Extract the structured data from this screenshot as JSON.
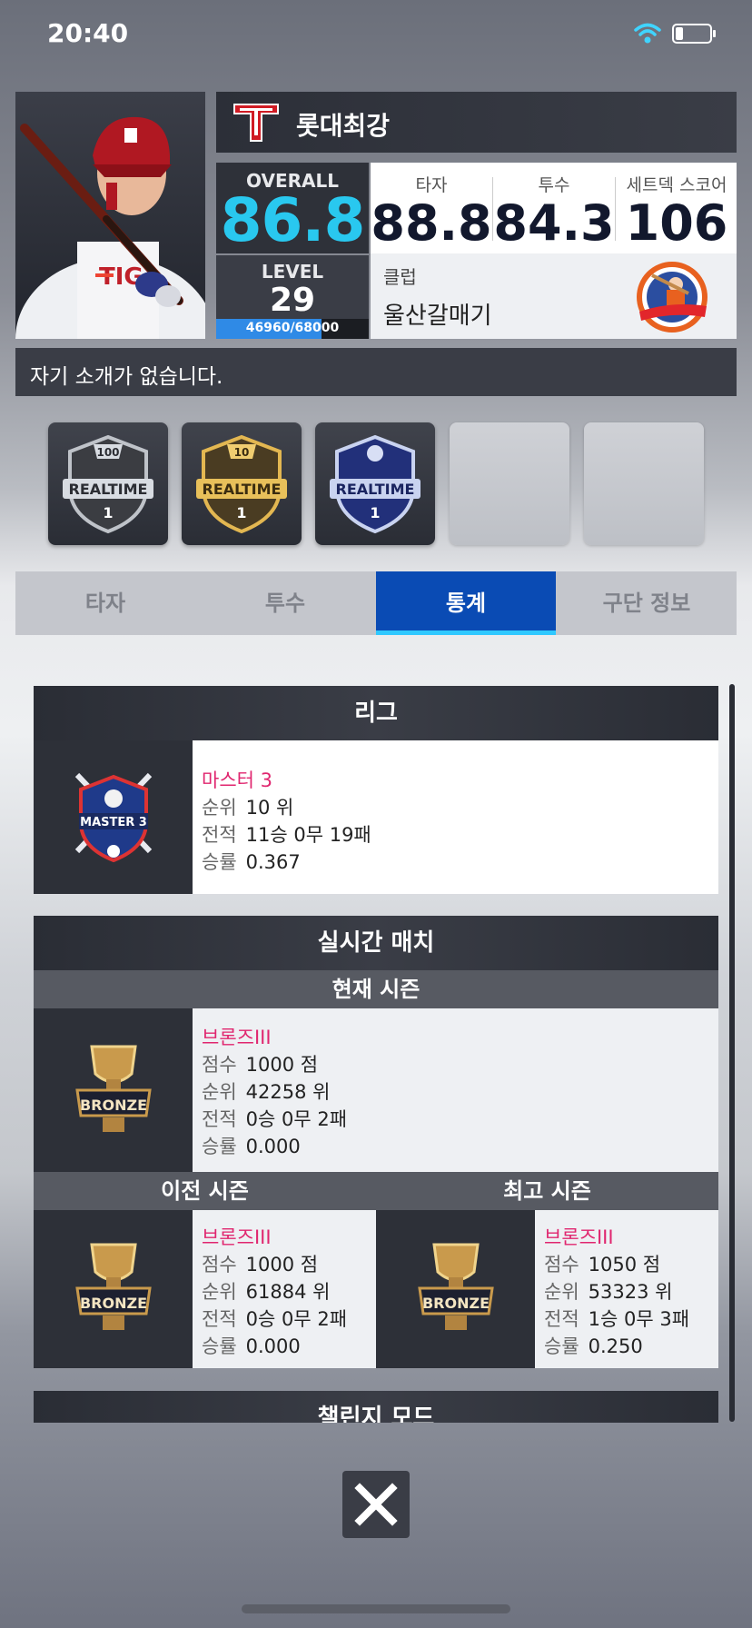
{
  "status": {
    "time": "20:40"
  },
  "profile": {
    "name": "롯대최강",
    "overall_label": "OVERALL",
    "overall_value": "86.8",
    "level_label": "LEVEL",
    "level_value": "29",
    "exp_text": "46960/68000",
    "exp_fraction": 0.69,
    "hitter_label": "타자",
    "hitter_value": "88.8",
    "pitcher_label": "투수",
    "pitcher_value": "84.3",
    "setdeck_label": "세트덱 스코어",
    "setdeck_value": "106",
    "club_label": "클럽",
    "club_value": "울산갈매기",
    "intro": "자기 소개가 없습니다."
  },
  "badges": [
    {
      "number": "100",
      "text": "REALTIME",
      "rank": "1",
      "tone": "silver"
    },
    {
      "number": "10",
      "text": "REALTIME",
      "rank": "1",
      "tone": "gold"
    },
    {
      "number": "",
      "text": "REALTIME",
      "rank": "1",
      "tone": "blue"
    }
  ],
  "tabs": [
    {
      "label": "타자"
    },
    {
      "label": "투수"
    },
    {
      "label": "통계"
    },
    {
      "label": "구단 정보"
    }
  ],
  "active_tab": "통계",
  "league": {
    "title": "리그",
    "emblem_text": "MASTER 3",
    "tier": "마스터 3",
    "rank_key": "순위",
    "rank_val": "10 위",
    "record_key": "전적",
    "record_val": "11승 0무 19패",
    "winrate_key": "승률",
    "winrate_val": "0.367"
  },
  "realtime": {
    "title": "실시간 매치",
    "current": {
      "title": "현재 시즌",
      "tier": "브론즈III",
      "score_key": "점수",
      "score_val": "1000 점",
      "rank_key": "순위",
      "rank_val": "42258 위",
      "record_key": "전적",
      "record_val": "0승 0무 2패",
      "winrate_key": "승률",
      "winrate_val": "0.000"
    },
    "previous": {
      "title": "이전 시즌",
      "tier": "브론즈III",
      "score_key": "점수",
      "score_val": "1000 점",
      "rank_key": "순위",
      "rank_val": "61884 위",
      "record_key": "전적",
      "record_val": "0승 0무 2패",
      "winrate_key": "승률",
      "winrate_val": "0.000"
    },
    "best": {
      "title": "최고 시즌",
      "tier": "브론즈III",
      "score_key": "점수",
      "score_val": "1050 점",
      "rank_key": "순위",
      "rank_val": "53323 위",
      "record_key": "전적",
      "record_val": "1승 0무 3패",
      "winrate_key": "승률",
      "winrate_val": "0.250"
    },
    "emblem_text": "BRONZE"
  },
  "challenge": {
    "title": "챌린지 모드"
  },
  "colors": {
    "accent_blue": "#0a4bb4",
    "overall_cyan": "#29c8ef",
    "tier_pink": "#e0266f"
  },
  "icons": {
    "close": "close-icon",
    "wifi": "wifi-icon",
    "battery": "battery-icon"
  }
}
